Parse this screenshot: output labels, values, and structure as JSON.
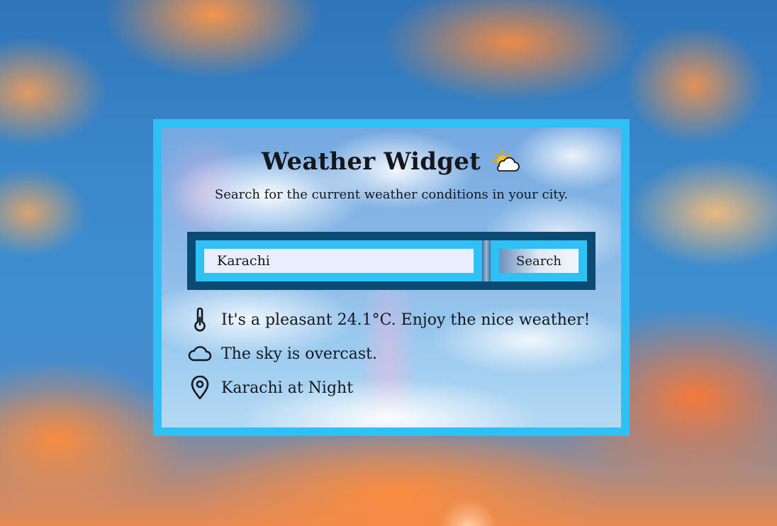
{
  "header": {
    "title": "Weather Widget",
    "title_icon": "sun-behind-cloud-icon",
    "subtitle": "Search for the current weather conditions in your city."
  },
  "search": {
    "value": "Karachi",
    "button_label": "Search"
  },
  "results": [
    {
      "icon": "thermometer-icon",
      "text": "It's a pleasant 24.1°C. Enjoy the nice weather!"
    },
    {
      "icon": "cloud-icon",
      "text": "The sky is overcast."
    },
    {
      "icon": "map-pin-icon",
      "text": "Karachi at Night"
    }
  ],
  "colors": {
    "frame": "#2fc0f5",
    "search_bar": "#0b4a73",
    "text": "#15171c"
  }
}
